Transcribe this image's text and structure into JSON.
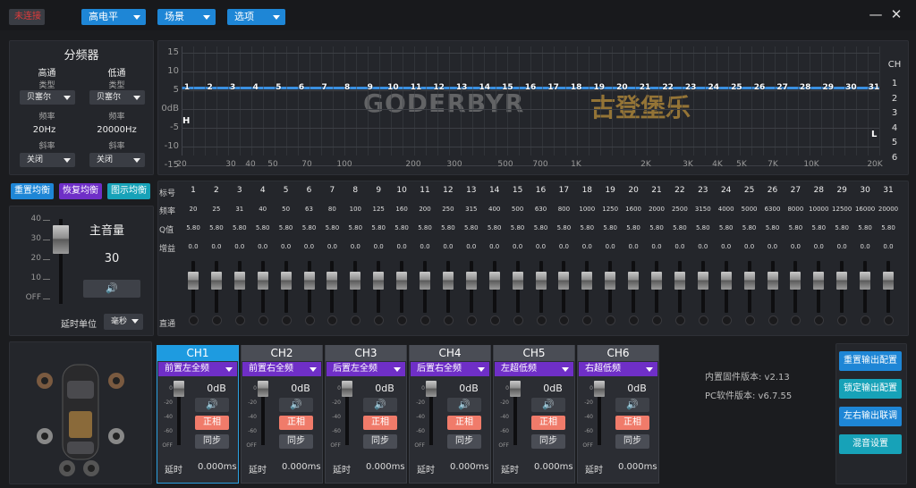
{
  "topbar": {
    "connect": "未连接",
    "menus": [
      "高电平",
      "场景",
      "选项"
    ],
    "minimize": "—",
    "close": "✕"
  },
  "crossover": {
    "title": "分频器",
    "high": "高通",
    "low": "低通",
    "type_label": "类型",
    "type_hp": "贝塞尔",
    "type_lp": "贝塞尔",
    "freq_label": "频率",
    "freq_hp": "20Hz",
    "freq_lp": "20000Hz",
    "slope_label": "斜率",
    "slope_hp": "关闭",
    "slope_lp": "关闭"
  },
  "eq_buttons": {
    "reset": "重置均衡",
    "restore": "恢复均衡",
    "graphic": "图示均衡"
  },
  "master": {
    "title": "主音量",
    "value": "30",
    "scale": [
      "40",
      "30",
      "20",
      "10",
      "OFF"
    ],
    "delay_unit_label": "延时单位",
    "delay_unit": "毫秒"
  },
  "graph": {
    "y_ticks": [
      "15",
      "10",
      "5",
      "0dB",
      "-5",
      "-10",
      "-15"
    ],
    "x_ticks": [
      "20",
      "30",
      "40",
      "50",
      "70",
      "100",
      "200",
      "300",
      "500",
      "700",
      "1K",
      "2K",
      "3K",
      "4K",
      "5K",
      "7K",
      "10K",
      "20K"
    ],
    "ch_label": "CH",
    "ch_nums": [
      "1",
      "2",
      "3",
      "4",
      "5",
      "6"
    ],
    "h_marker": "H",
    "l_marker": "L",
    "watermark": "GODERBYR",
    "watermark_cn": "古登堡乐"
  },
  "bands": {
    "row_labels": {
      "id": "标号",
      "freq": "频率",
      "q": "Q值",
      "gain": "增益",
      "bypass": "直通"
    },
    "ids": [
      "1",
      "2",
      "3",
      "4",
      "5",
      "6",
      "7",
      "8",
      "9",
      "10",
      "11",
      "12",
      "13",
      "14",
      "15",
      "16",
      "17",
      "18",
      "19",
      "20",
      "21",
      "22",
      "23",
      "24",
      "25",
      "26",
      "27",
      "28",
      "29",
      "30",
      "31"
    ],
    "freqs": [
      "20",
      "25",
      "31",
      "40",
      "50",
      "63",
      "80",
      "100",
      "125",
      "160",
      "200",
      "250",
      "315",
      "400",
      "500",
      "630",
      "800",
      "1000",
      "1250",
      "1600",
      "2000",
      "2500",
      "3150",
      "4000",
      "5000",
      "6300",
      "8000",
      "10000",
      "12500",
      "16000",
      "20000"
    ],
    "q": "5.80",
    "gain": "0.0"
  },
  "channels": [
    {
      "name": "CH1",
      "sel": "前置左全频",
      "db": "0dB",
      "phase": "正相",
      "sync": "同步",
      "delay_label": "延时",
      "delay": "0.000ms"
    },
    {
      "name": "CH2",
      "sel": "前置右全频",
      "db": "0dB",
      "phase": "正相",
      "sync": "同步",
      "delay_label": "延时",
      "delay": "0.000ms"
    },
    {
      "name": "CH3",
      "sel": "后置左全频",
      "db": "0dB",
      "phase": "正相",
      "sync": "同步",
      "delay_label": "延时",
      "delay": "0.000ms"
    },
    {
      "name": "CH4",
      "sel": "后置右全频",
      "db": "0dB",
      "phase": "正相",
      "sync": "同步",
      "delay_label": "延时",
      "delay": "0.000ms"
    },
    {
      "name": "CH5",
      "sel": "左超低频",
      "db": "0dB",
      "phase": "正相",
      "sync": "同步",
      "delay_label": "延时",
      "delay": "0.000ms"
    },
    {
      "name": "CH6",
      "sel": "右超低频",
      "db": "0dB",
      "phase": "正相",
      "sync": "同步",
      "delay_label": "延时",
      "delay": "0.000ms"
    }
  ],
  "ch_scale": [
    "0",
    "-20",
    "-40",
    "-60",
    "OFF"
  ],
  "version": {
    "fw": "内置固件版本: v2.13",
    "pc": "PC软件版本: v6.7.55"
  },
  "right_buttons": [
    "重置输出配置",
    "锁定输出配置",
    "左右输出联调",
    "混音设置"
  ],
  "colors": {
    "accent": "#1e86d6",
    "purple": "#6f2fc7",
    "teal": "#17a2b8",
    "phase": "#f07b6a",
    "curve": "#3a8fe0"
  }
}
